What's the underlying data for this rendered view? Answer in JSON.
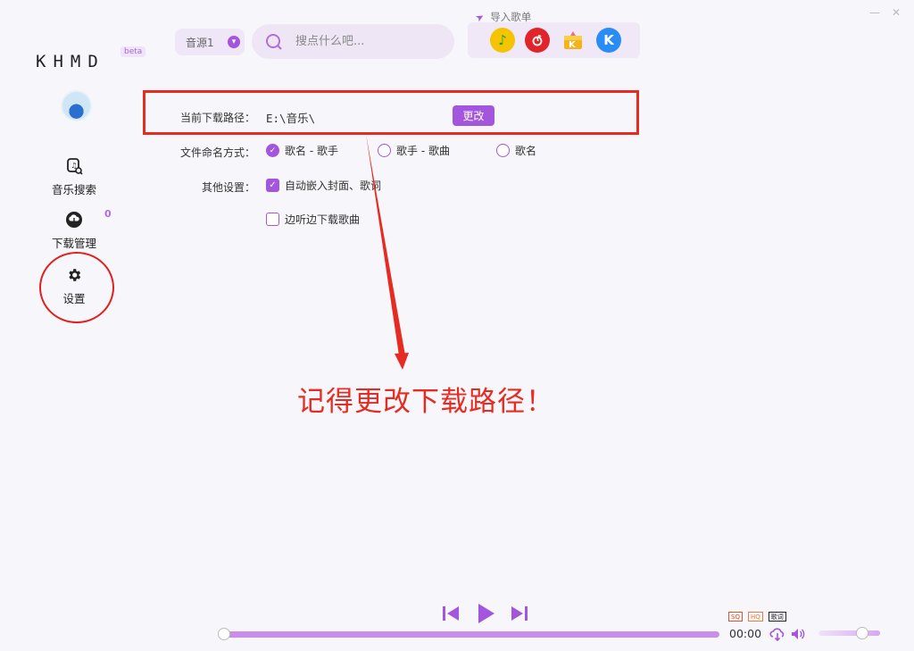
{
  "app": {
    "logo": "KHMD",
    "beta_badge": "beta"
  },
  "sidebar": {
    "items": [
      {
        "label": "音乐搜索",
        "icon": "music-search-icon"
      },
      {
        "label": "下载管理",
        "icon": "cloud-download-icon",
        "count": "0"
      },
      {
        "label": "设置",
        "icon": "gear-icon"
      }
    ]
  },
  "topbar": {
    "source_select": "音源1",
    "search_placeholder": "搜点什么吧...",
    "import_label": "导入歌单",
    "platforms": [
      "qq-music-icon",
      "netease-music-icon",
      "kuwo-music-icon",
      "kugou-music-icon"
    ]
  },
  "settings": {
    "path_label": "当前下载路径：",
    "path_value": "E:\\音乐\\",
    "change_button": "更改",
    "naming_label": "文件命名方式：",
    "naming_options": [
      "歌名 - 歌手",
      "歌手 - 歌曲",
      "歌名"
    ],
    "naming_selected": 0,
    "other_label": "其他设置：",
    "embed_option": "自动嵌入封面、歌词",
    "embed_checked": true,
    "stream_option": "边听边下载歌曲",
    "stream_checked": false
  },
  "annotation": {
    "text": "记得更改下载路径！",
    "color": "#e62b23"
  },
  "player": {
    "time": "00:00",
    "badges": [
      "SQ",
      "HQ",
      "歌词"
    ],
    "progress": 0,
    "volume": 0.72
  },
  "colors": {
    "accent": "#a455dd",
    "annotation_red": "#e62b23"
  }
}
